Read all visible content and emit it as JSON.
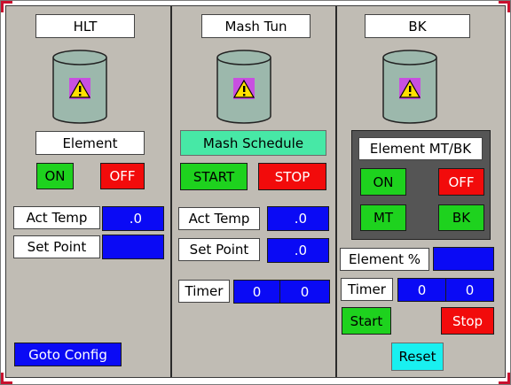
{
  "columns": {
    "hlt": {
      "title": "HLT",
      "element_label": "Element",
      "on_label": "ON",
      "off_label": "OFF",
      "act_temp_label": "Act Temp",
      "act_temp_value": ".0",
      "set_point_label": "Set Point",
      "set_point_value": ""
    },
    "mash": {
      "title": "Mash Tun",
      "schedule_label": "Mash Schedule",
      "start_label": "START",
      "stop_label": "STOP",
      "act_temp_label": "Act Temp",
      "act_temp_value": ".0",
      "set_point_label": "Set Point",
      "set_point_value": ".0",
      "timer_label": "Timer",
      "timer_min": "0",
      "timer_sec": "0"
    },
    "bk": {
      "title": "BK",
      "element_group_label": "Element MT/BK",
      "on_label": "ON",
      "off_label": "OFF",
      "mt_label": "MT",
      "bk_label": "BK",
      "element_pct_label": "Element %",
      "element_pct_value": "",
      "timer_label": "Timer",
      "timer_min": "0",
      "timer_sec": "0",
      "start_label": "Start",
      "stop_label": "Stop",
      "reset_label": "Reset"
    }
  },
  "goto_config_label": "Goto Config",
  "colors": {
    "panel": "#c0bcb4",
    "green": "#1ed21e",
    "red": "#f20b0b",
    "blue": "#0a0af5",
    "teal": "#47e8a6",
    "cyan": "#19f0f0",
    "tank": "#9cb8ac",
    "warning": "#ffe000"
  },
  "icons": {
    "tank": "vessel-icon",
    "warning": "warning-icon"
  }
}
